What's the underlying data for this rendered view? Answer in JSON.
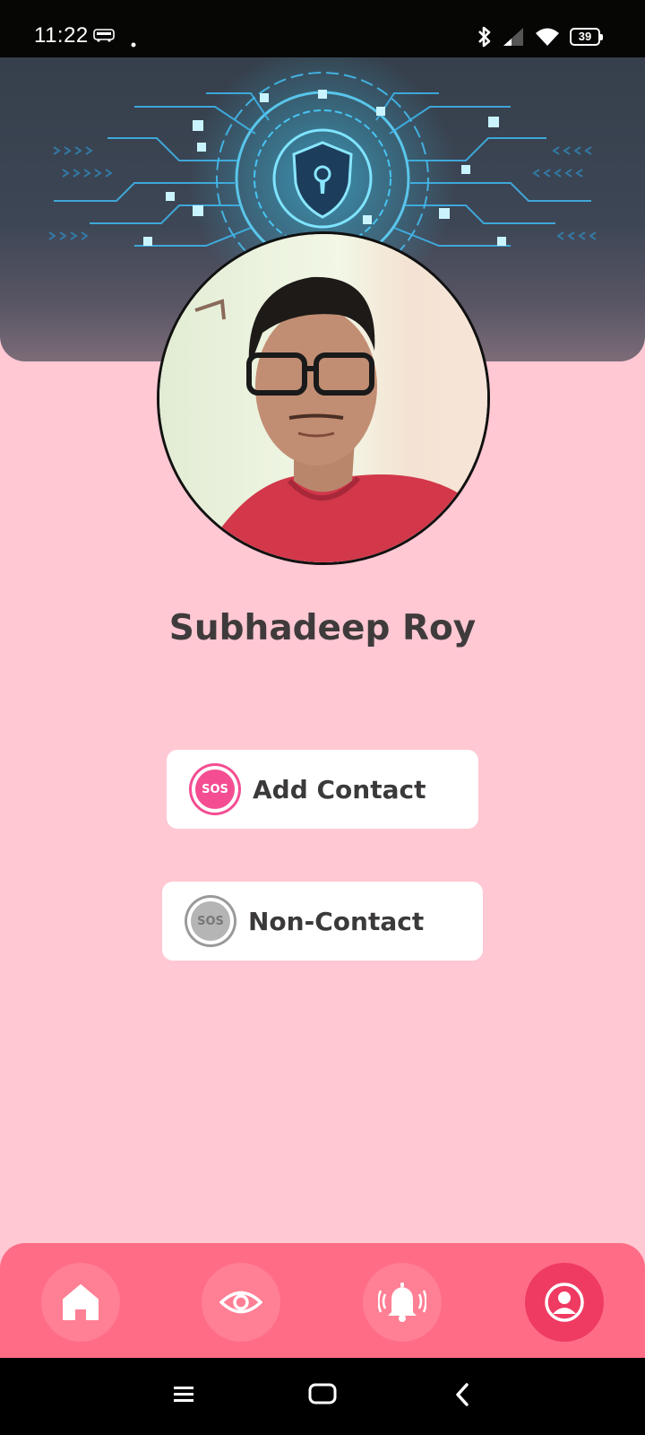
{
  "status_bar": {
    "time": "11:22",
    "battery_level": "39",
    "icons": [
      "redbus-notification-icon",
      "dot-icon",
      "bluetooth-icon",
      "signal-icon",
      "wifi-icon",
      "battery-icon"
    ]
  },
  "profile": {
    "name": "Subhadeep Roy"
  },
  "actions": {
    "add_contact": {
      "label": "Add Contact",
      "badge": "SOS"
    },
    "non_contact": {
      "label": "Non-Contact",
      "badge": "SOS"
    }
  },
  "bottom_nav": {
    "items": [
      "home-icon",
      "eye-icon",
      "alarm-bell-icon",
      "profile-icon"
    ],
    "active": "profile-icon"
  },
  "colors": {
    "background": "#ffc8d3",
    "nav_bar": "#ff6c85",
    "nav_active": "#ef3b62",
    "sos_active": "#f44d92",
    "text": "#3f3b3c"
  }
}
